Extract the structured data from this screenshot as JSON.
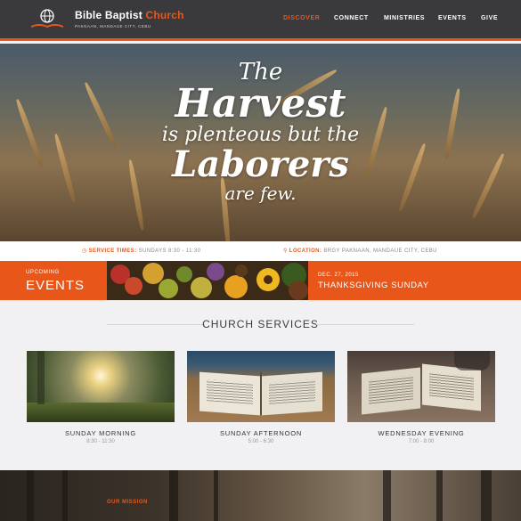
{
  "header": {
    "brand_main": "Bible Baptist",
    "brand_accent": "Church",
    "brand_sub": "PAKNAAN, MANDAUE CITY, CEBU",
    "nav": [
      {
        "label": "DISCOVER",
        "active": true
      },
      {
        "label": "CONNECT",
        "active": false
      },
      {
        "label": "MINISTRIES",
        "active": false
      },
      {
        "label": "EVENTS",
        "active": false
      },
      {
        "label": "GIVE",
        "active": false
      }
    ]
  },
  "hero": {
    "line1": "The",
    "line2": "Harvest",
    "line3": "is plenteous but the",
    "line4": "Laborers",
    "line5": "are few."
  },
  "infobar": {
    "service_label": "SERVICE TIMES:",
    "service_value": "SUNDAYS 8:30 - 11:30",
    "location_label": "LOCATION:",
    "location_value": "BRGY PAKNAAN, MANDAUE CITY, CEBU"
  },
  "events": {
    "upcoming": "UPCOMING",
    "title": "EVENTS",
    "date": "DEC. 27, 2015",
    "name": "THANKSGIVING SUNDAY"
  },
  "services": {
    "heading": "CHURCH SERVICES",
    "items": [
      {
        "title": "SUNDAY MORNING",
        "time": "8:30 - 11:30"
      },
      {
        "title": "SUNDAY AFTERNOON",
        "time": "5:00 - 6:30"
      },
      {
        "title": "WEDNESDAY EVENING",
        "time": "7:00 - 8:00"
      }
    ]
  },
  "mission": {
    "label": "OUR MISSION"
  },
  "colors": {
    "accent": "#e8561a",
    "header_bg": "#3a3a3c",
    "page_bg": "#f1f1f3"
  }
}
